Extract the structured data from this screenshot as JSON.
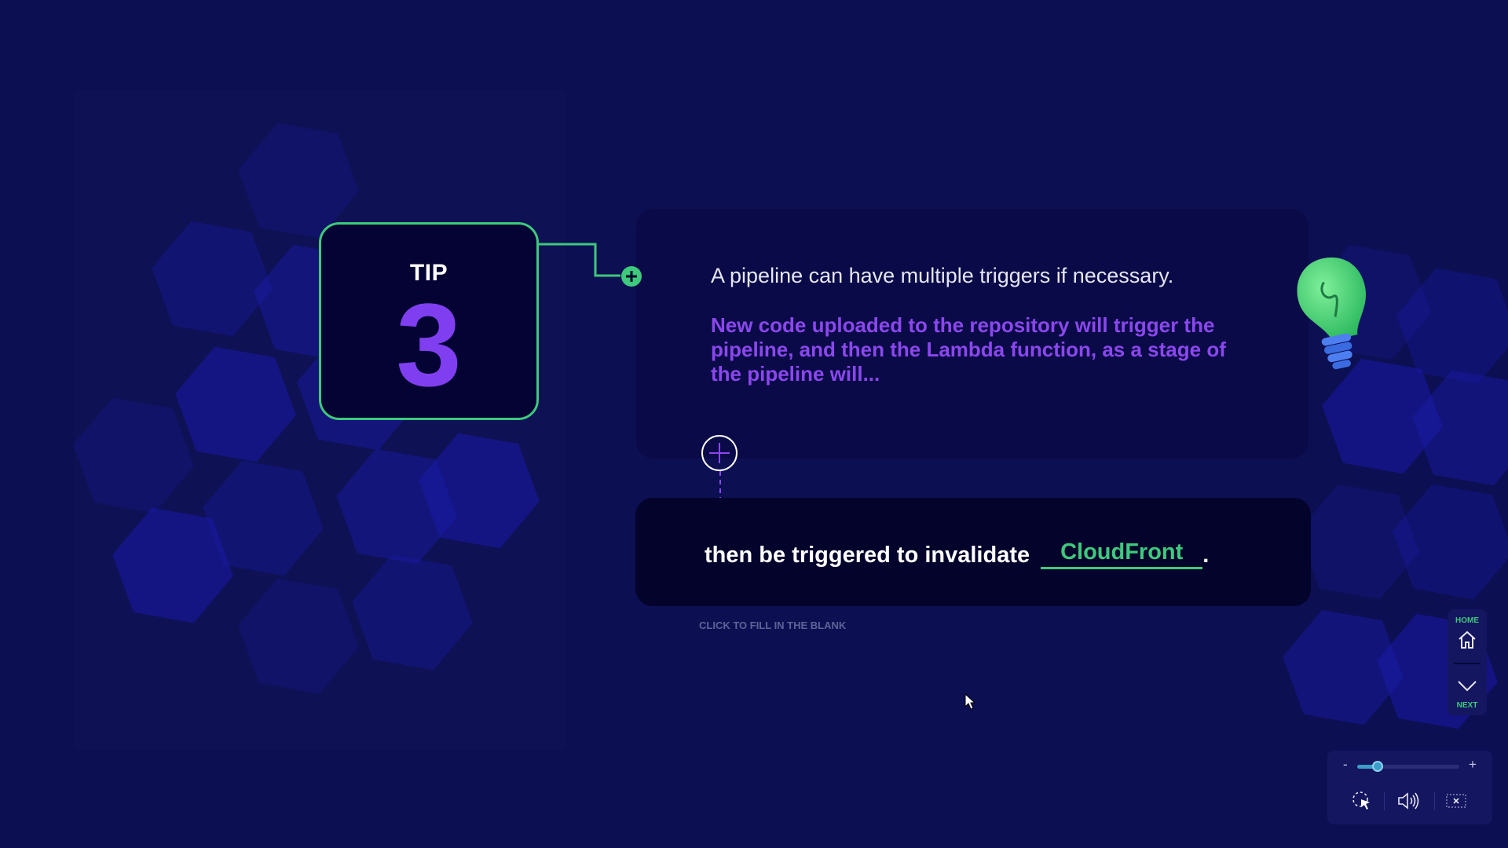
{
  "tip": {
    "label": "TIP",
    "number": "3"
  },
  "info": {
    "statement": "A pipeline can have multiple triggers if necessary.",
    "question": "New code uploaded to the repository will trigger the pipeline, and then the Lambda function, as a stage of the pipeline will..."
  },
  "blank": {
    "prefix": "then be triggered to invalidate",
    "answer": "CloudFront",
    "suffix": ".",
    "hint": "CLICK TO FILL IN THE BLANK"
  },
  "nav": {
    "home_label": "HOME",
    "next_label": "NEXT"
  },
  "controls": {
    "zoom_minus": "-",
    "zoom_plus": "+",
    "zoom_level": 0.2
  },
  "colors": {
    "accent_green": "#3ec97c",
    "accent_purple": "#7f3ff0",
    "background": "#0c0f52"
  },
  "icons": {
    "connector_plus": "plus-circle-icon",
    "bulb": "lightbulb-icon",
    "expand": "plus-icon",
    "home": "home-icon",
    "next": "chevron-down-icon",
    "pointer_settings": "pointer-icon",
    "audio": "speaker-icon",
    "close": "close-icon"
  }
}
